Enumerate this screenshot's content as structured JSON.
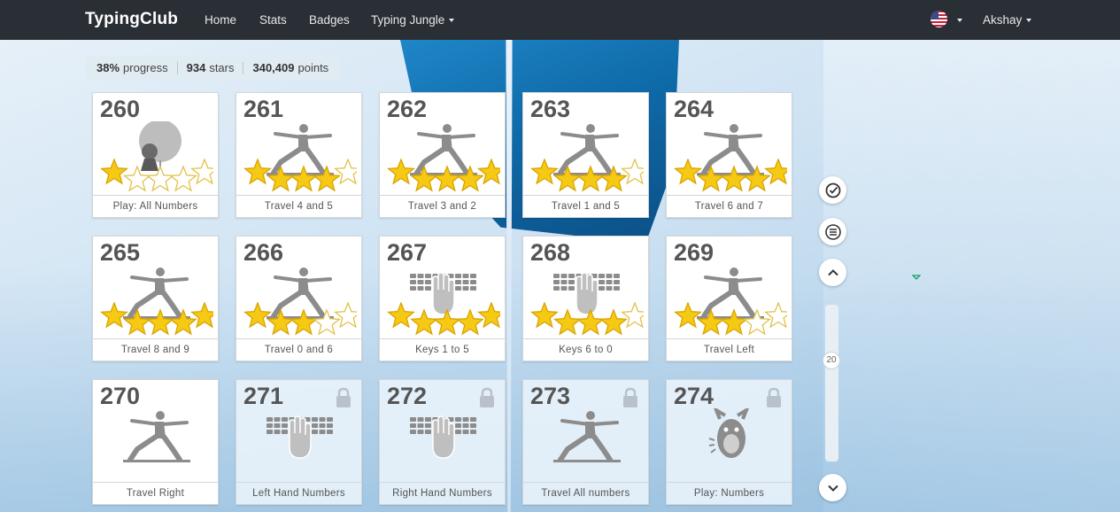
{
  "navbar": {
    "brand": "TypingClub",
    "items": [
      {
        "label": "Home"
      },
      {
        "label": "Stats"
      },
      {
        "label": "Badges"
      },
      {
        "label": "Typing Jungle"
      }
    ],
    "language_icon": "us-flag-icon",
    "user": "Akshay"
  },
  "progress": {
    "percent": "38%",
    "percent_label": "progress",
    "stars": "934",
    "stars_label": "stars",
    "points": "340,409",
    "points_label": "points"
  },
  "lessons": [
    {
      "number": "260",
      "label": "Play: All Numbers",
      "stars": 1,
      "icon": "balloon-character-icon",
      "locked": false
    },
    {
      "number": "261",
      "label": "Travel 4 and 5",
      "stars": 4,
      "icon": "lunge-figure-icon",
      "locked": false
    },
    {
      "number": "262",
      "label": "Travel 3 and 2",
      "stars": 5,
      "icon": "lunge-figure-icon",
      "locked": false
    },
    {
      "number": "263",
      "label": "Travel 1 and 5",
      "stars": 4,
      "icon": "lunge-figure-icon",
      "locked": false
    },
    {
      "number": "264",
      "label": "Travel 6 and 7",
      "stars": 5,
      "icon": "lunge-figure-icon",
      "locked": false
    },
    {
      "number": "265",
      "label": "Travel 8 and 9",
      "stars": 5,
      "icon": "lunge-figure-icon",
      "locked": false
    },
    {
      "number": "266",
      "label": "Travel 0 and 6",
      "stars": 3,
      "icon": "lunge-figure-icon",
      "locked": false
    },
    {
      "number": "267",
      "label": "Keys 1 to 5",
      "stars": 5,
      "icon": "keyboard-hand-icon",
      "locked": false
    },
    {
      "number": "268",
      "label": "Keys 6 to 0",
      "stars": 4,
      "icon": "keyboard-hand-icon",
      "locked": false
    },
    {
      "number": "269",
      "label": "Travel Left",
      "stars": 3,
      "icon": "lunge-figure-icon",
      "locked": false
    },
    {
      "number": "270",
      "label": "Travel Right",
      "stars": 0,
      "icon": "lunge-figure-icon",
      "locked": false
    },
    {
      "number": "271",
      "label": "Left Hand Numbers",
      "stars": 0,
      "icon": "keyboard-hand-icon",
      "locked": true
    },
    {
      "number": "272",
      "label": "Right Hand Numbers",
      "stars": 0,
      "icon": "keyboard-hand-icon",
      "locked": true
    },
    {
      "number": "273",
      "label": "Travel All numbers",
      "stars": 0,
      "icon": "lunge-figure-icon",
      "locked": true
    },
    {
      "number": "274",
      "label": "Play: Numbers",
      "stars": 0,
      "icon": "monster-character-icon",
      "locked": true
    }
  ],
  "side_controls": {
    "scroll_value": "20",
    "buttons": [
      "check-circle-icon",
      "menu-icon",
      "chevron-up-icon",
      "chevron-down-icon"
    ]
  },
  "colors": {
    "navbar": "#2a2e35",
    "star_fill": "#f6c915",
    "star_empty": "#ffffff",
    "illustration_gray": "#8c8c8c"
  }
}
